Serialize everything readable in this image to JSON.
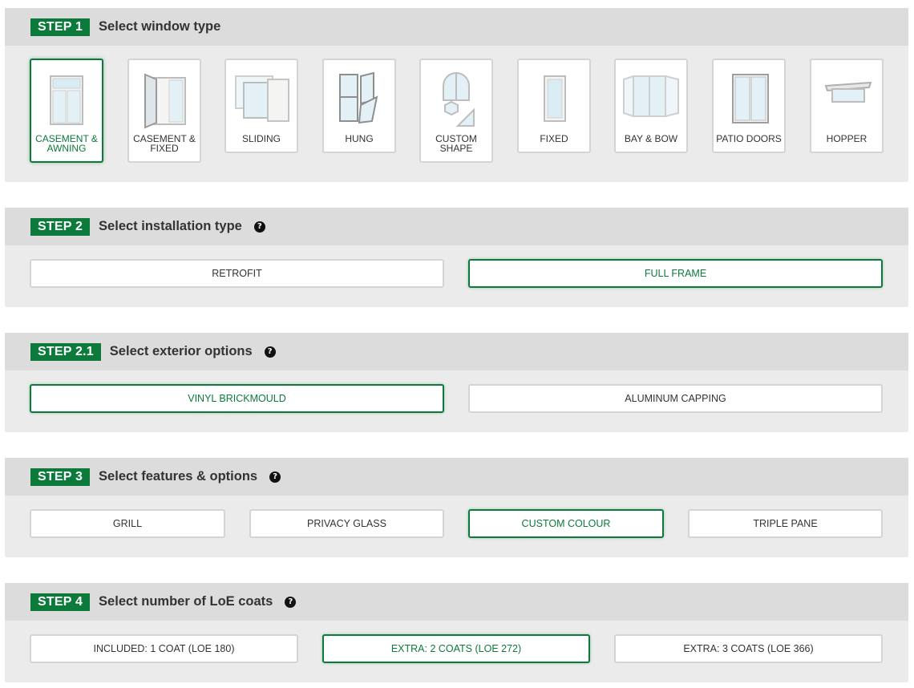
{
  "colors": {
    "accent": "#0b7a3a",
    "section_bg": "#ebebeb",
    "header_bg": "#dcdcdc",
    "border": "#d4d4d4"
  },
  "step1": {
    "badge": "STEP 1",
    "title": "Select window type",
    "selected": "casement-awning",
    "window_types": [
      {
        "label_line1": "CASEMENT &",
        "label_line2": "AWNING",
        "icon": "casement-awning-window-icon"
      },
      {
        "label_line1": "CASEMENT &",
        "label_line2": "FIXED",
        "icon": "casement-fixed-window-icon"
      },
      {
        "label_line1": "SLIDING",
        "label_line2": "",
        "icon": "sliding-window-icon"
      },
      {
        "label_line1": "HUNG",
        "label_line2": "",
        "icon": "hung-window-icon"
      },
      {
        "label_line1": "CUSTOM",
        "label_line2": "SHAPE",
        "icon": "custom-shape-window-icon"
      },
      {
        "label_line1": "FIXED",
        "label_line2": "",
        "icon": "fixed-window-icon"
      },
      {
        "label_line1": "BAY & BOW",
        "label_line2": "",
        "icon": "bay-bow-window-icon"
      },
      {
        "label_line1": "PATIO DOORS",
        "label_line2": "",
        "icon": "patio-door-icon"
      },
      {
        "label_line1": "HOPPER",
        "label_line2": "",
        "icon": "hopper-window-icon"
      }
    ]
  },
  "step2": {
    "badge": "STEP 2",
    "title": "Select installation type",
    "help_icon": "question-circle-icon",
    "help_glyph": "?",
    "options": [
      "RETROFIT",
      "FULL FRAME"
    ],
    "selected": "FULL FRAME"
  },
  "step21": {
    "badge": "STEP 2.1",
    "title": "Select exterior options",
    "help_glyph": "?",
    "options": [
      "VINYL BRICKMOULD",
      "ALUMINUM CAPPING"
    ],
    "selected": "VINYL BRICKMOULD"
  },
  "step3": {
    "badge": "STEP 3",
    "title": "Select features & options",
    "help_glyph": "?",
    "options": [
      "GRILL",
      "PRIVACY GLASS",
      "CUSTOM COLOUR",
      "TRIPLE PANE"
    ],
    "selected": "CUSTOM COLOUR"
  },
  "step4": {
    "badge": "STEP 4",
    "title": "Select number of LoE coats",
    "help_glyph": "?",
    "options": [
      "INCLUDED: 1 COAT (LOE 180)",
      "EXTRA: 2 COATS (LOE 272)",
      "EXTRA: 3 COATS (LOE 366)"
    ],
    "selected": "EXTRA: 2 COATS (LOE 272)"
  }
}
